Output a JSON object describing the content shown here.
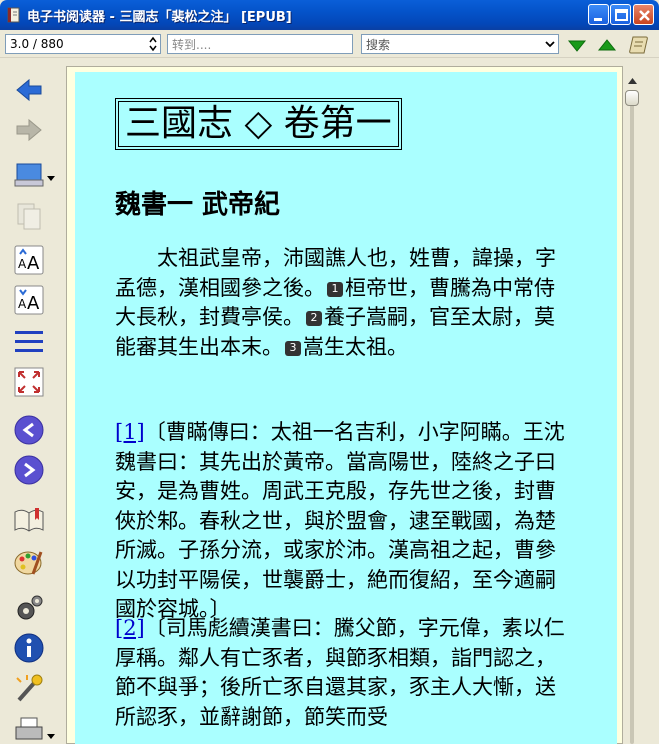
{
  "window": {
    "title": "电子书阅读器 - 三國志「裴松之注」 [EPUB]"
  },
  "toolbar": {
    "page_value": "3.0 / 880",
    "goto_placeholder": "转到....",
    "search_placeholder": "搜索"
  },
  "icons": {
    "app": "book-app-icon",
    "minimize": "minimize-icon",
    "maximize": "maximize-icon",
    "close": "close-icon",
    "find_next": "triangle-down-icon",
    "find_prev": "triangle-up-icon",
    "scroll": "scroll-icon"
  },
  "colors": {
    "page_bg": "#aaffff",
    "frame_bg": "#ffffe0",
    "nav_blue": "#2b6bd6",
    "link": "#0000cc",
    "find_green": "#1a9a1a"
  },
  "book": {
    "title": "三國志 ◇ 卷第一",
    "chapter": "魏書一 武帝紀",
    "main_text": {
      "part1": "　　太祖武皇帝，沛國譙人也，姓曹，諱操，字孟德，漢相國參之後。",
      "mark1": "1",
      "part2": "桓帝世，曹騰為中常侍大長秋，封費亭侯。",
      "mark2": "2",
      "part3": "養子嵩嗣，官至太尉，莫能審其生出本末。",
      "mark3": "3",
      "part4": "嵩生太祖。"
    },
    "notes": [
      {
        "link": "[1]",
        "text": "〔曹瞞傳曰：太祖一名吉利，小字阿瞞。王沈魏書曰：其先出於黃帝。當高陽世，陸終之子曰安，是為曹姓。周武王克殷，存先世之後，封曹俠於邾。春秋之世，與於盟會，逮至戰國，為楚所滅。子孫分流，或家於沛。漢高祖之起，曹參以功封平陽侯，世襲爵士，絶而復紹，至今適嗣國於容城。〕"
      },
      {
        "link": "[2]",
        "text": "〔司馬彪續漢書曰：騰父節，字元偉，素以仁厚稱。鄰人有亡豕者，與節豕相類，詣門認之，節不與爭；後所亡豕自還其家，豕主人大慚，送所認豕，並辭謝節，節笑而受"
      }
    ]
  }
}
